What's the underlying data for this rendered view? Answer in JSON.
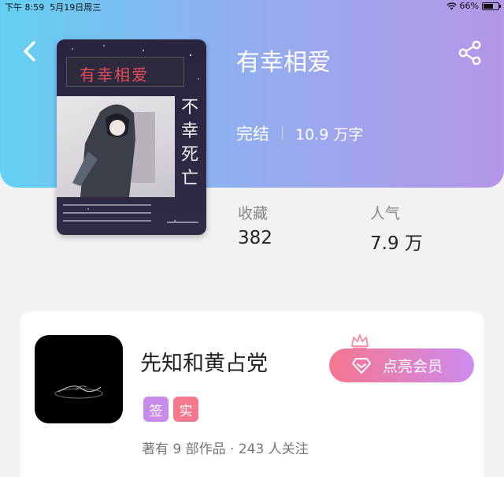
{
  "status_bar": {
    "time": "下午 8:59",
    "date": "5月19日周三",
    "battery": "66%",
    "battery_level": 0.66
  },
  "header": {
    "back_icon": "chevron-left-icon",
    "share_icon": "share-icon"
  },
  "book": {
    "title": "有幸相爱",
    "status": "完结",
    "word_count": "10.9 万字",
    "cover": {
      "title_text": "有幸相爱",
      "side_text": "不幸死亡"
    }
  },
  "stats": {
    "favorites_label": "收藏",
    "favorites_value": "382",
    "popularity_label": "人气",
    "popularity_value": "7.9 万"
  },
  "author": {
    "name": "先知和黄占党",
    "badges": [
      "签",
      "实"
    ],
    "summary": "著有 9 部作品 · 243 人关注",
    "vip_button": "点亮会员"
  },
  "colors": {
    "hero_start": "#63d0f3",
    "hero_end": "#b596e8",
    "badge_sign": "#c88bea",
    "badge_real": "#f5788f",
    "vip_start": "#f6768f",
    "vip_end": "#cc8cef"
  }
}
